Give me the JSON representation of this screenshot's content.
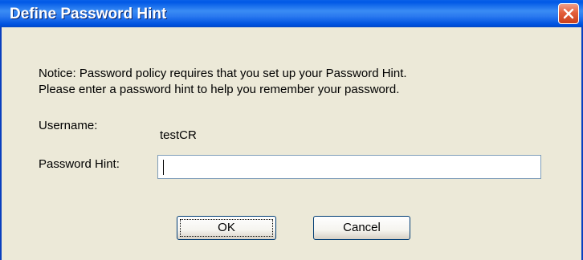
{
  "window": {
    "title": "Define Password Hint",
    "title_bar_color": "#0058e6",
    "close_icon": "close-icon"
  },
  "notice": {
    "line1": "Notice: Password policy requires that you set up your Password Hint.",
    "line2": "Please enter a password hint to help you remember your password."
  },
  "form": {
    "username_label": "Username:",
    "username_value": "testCR",
    "hint_label": "Password Hint:",
    "hint_value": ""
  },
  "buttons": {
    "ok_label": "OK",
    "cancel_label": "Cancel"
  }
}
